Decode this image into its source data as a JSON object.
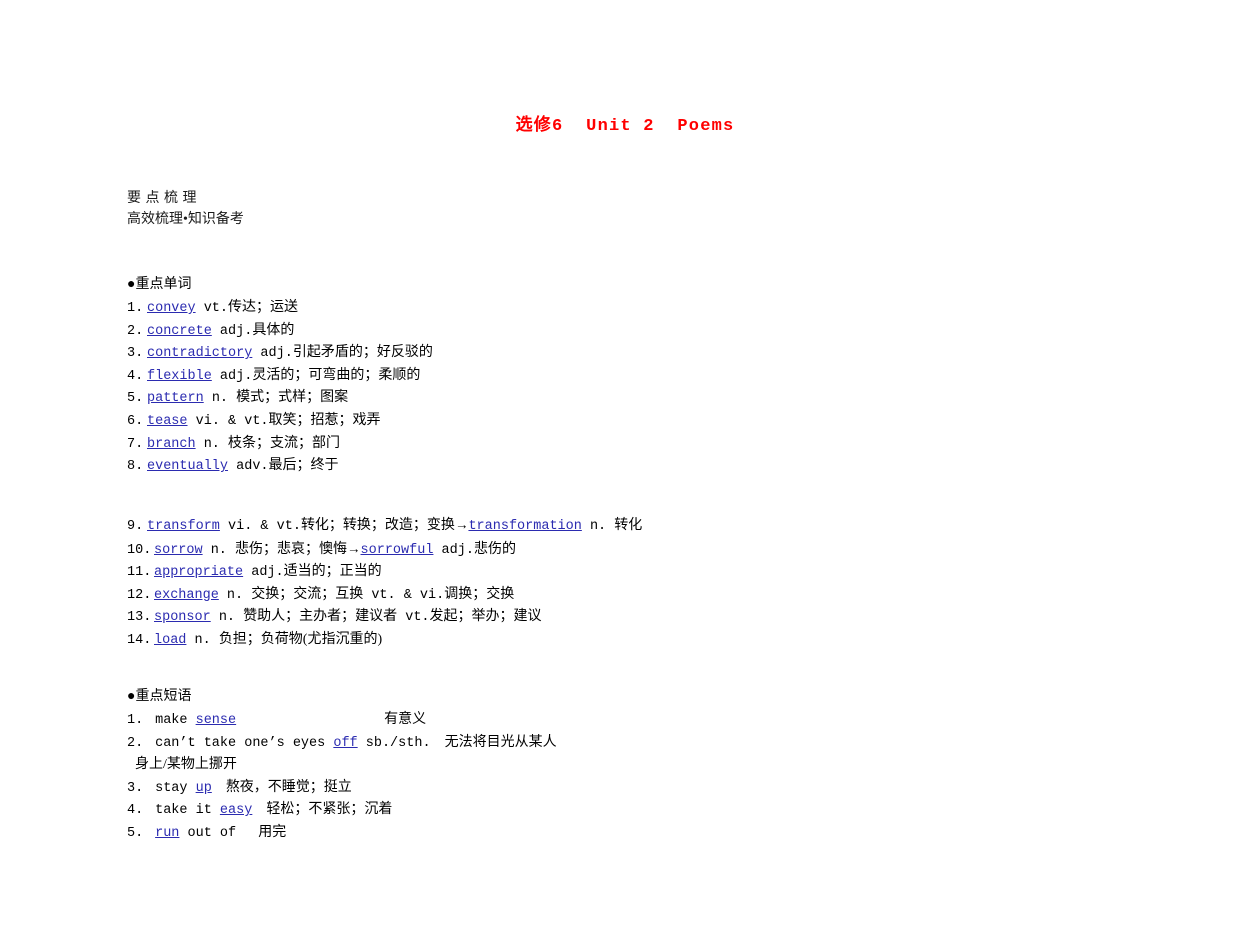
{
  "title": "选修6  Unit 2  Poems",
  "section": {
    "heading": "要 点 梳 理",
    "subheading": "高效梳理•知识备考"
  },
  "words": {
    "group_label": "●重点单词",
    "items": [
      {
        "num": "1.",
        "kw": "convey",
        "rest": " vt.",
        "cn": "传达；运送"
      },
      {
        "num": "2.",
        "kw": "concrete",
        "rest": " adj.",
        "cn": "具体的"
      },
      {
        "num": "3.",
        "kw": "contradictory",
        "rest": " adj.",
        "cn": "引起矛盾的；好反驳的"
      },
      {
        "num": "4.",
        "kw": "flexible",
        "rest": " adj.",
        "cn": "灵活的；可弯曲的；柔顺的"
      },
      {
        "num": "5.",
        "kw": "pattern",
        "rest": " n. ",
        "cn": "模式；式样；图案"
      },
      {
        "num": "6.",
        "kw": "tease",
        "rest": " vi. & vt.",
        "cn": "取笑；招惹；戏弄"
      },
      {
        "num": "7.",
        "kw": "branch",
        "rest": " n. ",
        "cn": "枝条；支流；部门"
      },
      {
        "num": "8.",
        "kw": "eventually",
        "rest": " adv.",
        "cn": "最后；终于"
      }
    ],
    "items2": [
      {
        "num": "9.",
        "kw": "transform",
        "rest": " vi. & vt.",
        "cn": "转化；转换；改造；变换",
        "arrow": "→",
        "kw2": "transformation",
        "rest2": " n. ",
        "cn2": "转化"
      },
      {
        "num": "10.",
        "kw": "sorrow",
        "rest": " n. ",
        "cn": "悲伤；悲哀；懊悔",
        "arrow": "→",
        "kw2": "sorrowful",
        "rest2": " adj.",
        "cn2": "悲伤的"
      },
      {
        "num": "11.",
        "kw": "appropriate",
        "rest": " adj.",
        "cn": "适当的；正当的",
        "arrow": "",
        "kw2": "",
        "rest2": "",
        "cn2": ""
      },
      {
        "num": "12.",
        "kw": "exchange",
        "rest": " n. ",
        "cn": "交换；交流；互换",
        "arrow": "",
        "kw2": "",
        "rest2": " vt. & vi.",
        "cn2": "调换；交换"
      },
      {
        "num": "13.",
        "kw": "sponsor",
        "rest": " n. ",
        "cn": "赞助人；主办者；建议者",
        "arrow": "",
        "kw2": "",
        "rest2": " vt.",
        "cn2": "发起；举办；建议"
      },
      {
        "num": "14.",
        "kw": "load",
        "rest": " n. ",
        "cn": "负担；负荷物(尤指沉重的)",
        "arrow": "",
        "kw2": "",
        "rest2": "",
        "cn2": ""
      }
    ]
  },
  "phrases": {
    "group_label": "●重点短语",
    "items": [
      {
        "num": "1.",
        "pre": " make ",
        "kw": "sense",
        "post": "",
        "cn": "有意义",
        "wrap": "",
        "wide_gap": true
      },
      {
        "num": "2.",
        "pre": " can’t take one’s eyes ",
        "kw": "off",
        "post": " sb./sth.",
        "cn": "无法将目光从某人",
        "wrap": "身上/某物上挪开",
        "wide_gap": false
      },
      {
        "num": "3.",
        "pre": " stay ",
        "kw": "up",
        "post": "",
        "cn": "熬夜，不睡觉；挺立",
        "wrap": "",
        "wide_gap": false
      },
      {
        "num": "4.",
        "pre": " take it ",
        "kw": "easy",
        "post": "",
        "cn": "轻松；不紧张；沉着",
        "wrap": "",
        "wide_gap": false
      },
      {
        "num": "5.",
        "pre": " ",
        "kw": "run",
        "post": " out of ",
        "cn": "用完",
        "wrap": "",
        "wide_gap": false
      }
    ]
  },
  "colors": {
    "title_red": "#ff0000",
    "keyword_blue": "#2b2bb0",
    "text_black": "#000000",
    "background": "#ffffff"
  }
}
